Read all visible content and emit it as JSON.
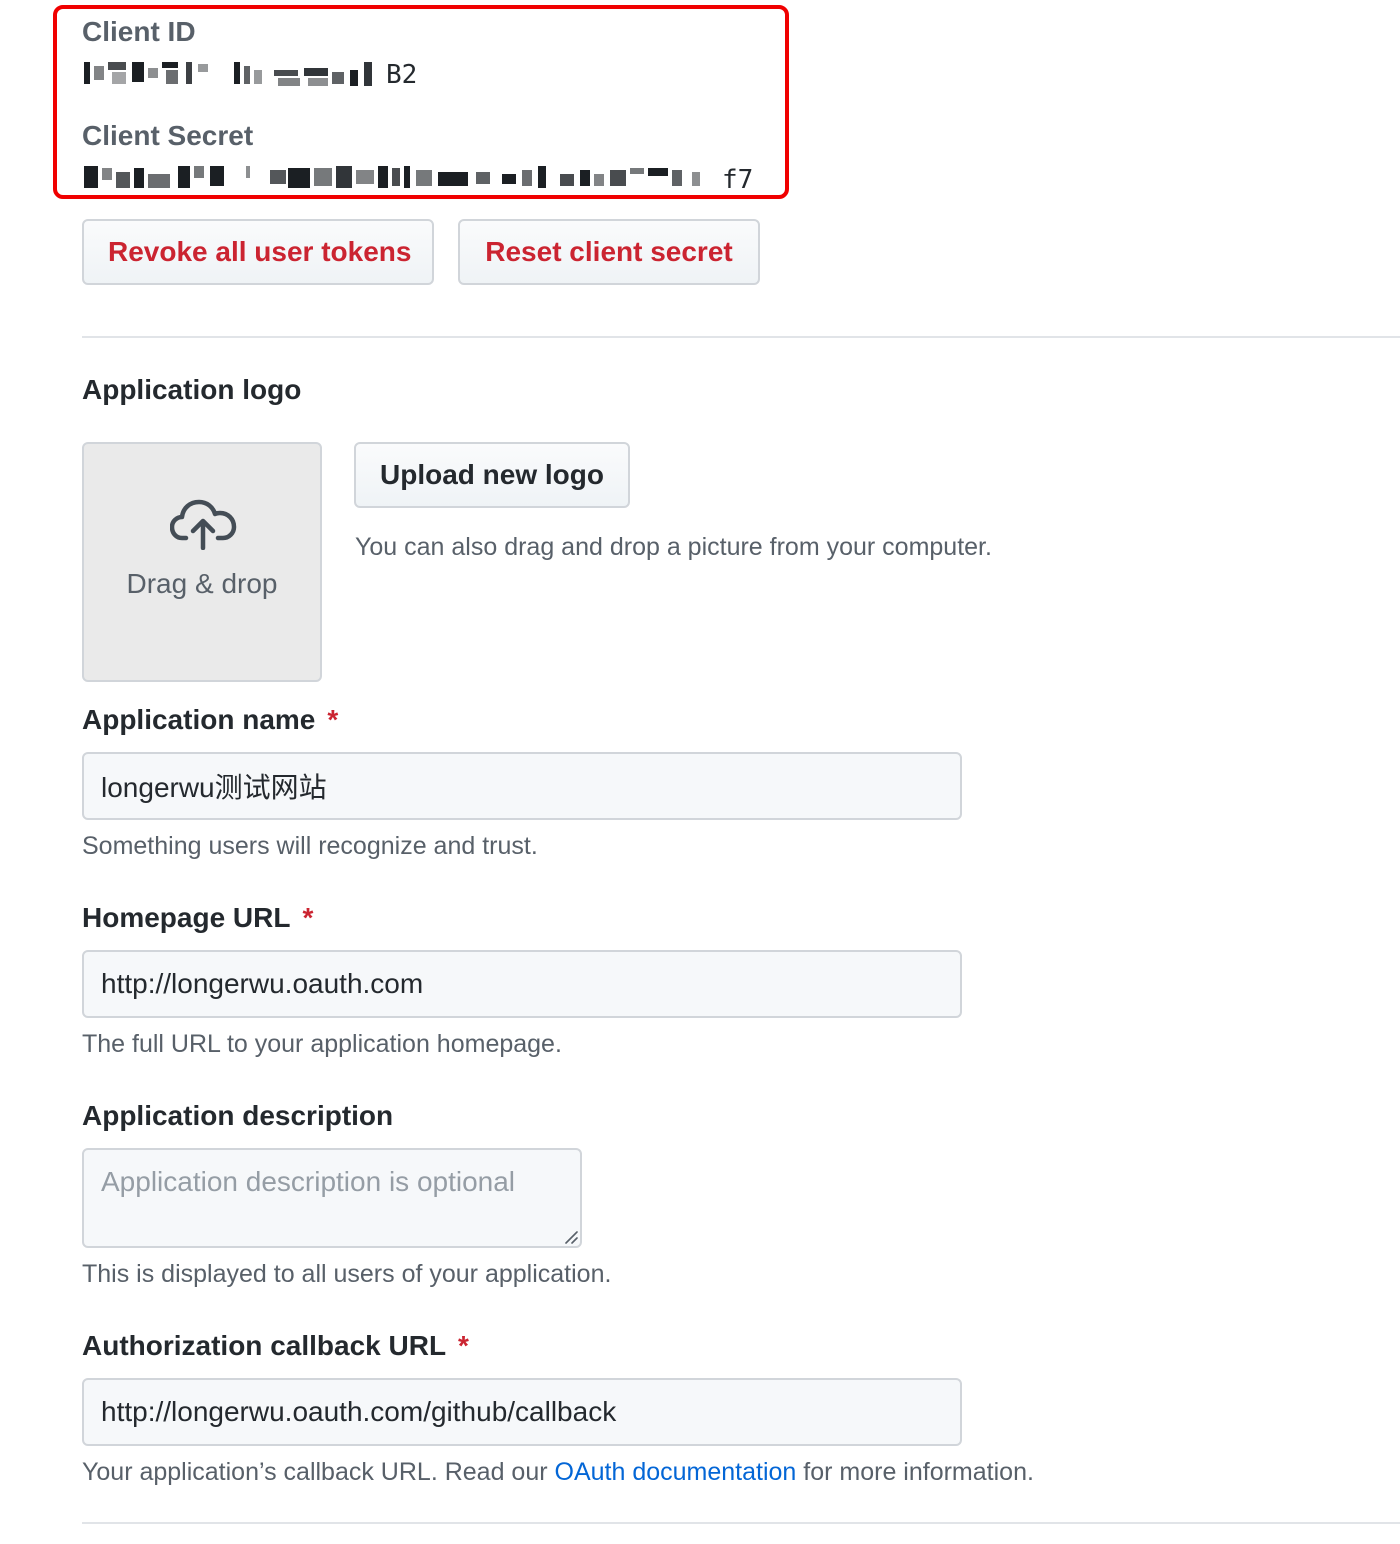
{
  "credentials": {
    "client_id_label": "Client ID",
    "client_id_value_visible_suffix": "B2",
    "client_secret_label": "Client Secret",
    "client_secret_value_visible_suffix": "f7"
  },
  "actions": {
    "revoke_tokens_label": "Revoke all user tokens",
    "reset_secret_label": "Reset client secret"
  },
  "logo": {
    "heading": "Application logo",
    "dropzone_label": "Drag & drop",
    "upload_button_label": "Upload new logo",
    "hint": "You can also drag and drop a picture from your computer."
  },
  "app_name": {
    "label": "Application name",
    "required_mark": "*",
    "value": "longerwu测试网站",
    "note": "Something users will recognize and trust."
  },
  "homepage": {
    "label": "Homepage URL",
    "required_mark": "*",
    "value": "http://longerwu.oauth.com",
    "note": "The full URL to your application homepage."
  },
  "description": {
    "label": "Application description",
    "placeholder": "Application description is optional",
    "value": "",
    "note": "This is displayed to all users of your application."
  },
  "callback": {
    "label": "Authorization callback URL",
    "required_mark": "*",
    "value": "http://longerwu.oauth.com/github/callback",
    "note_prefix": "Your application’s callback URL. Read our ",
    "note_link": "OAuth documentation",
    "note_suffix": " for more information."
  },
  "colors": {
    "highlight_box": "#f00000",
    "danger": "#cb2431",
    "link": "#0366d6",
    "muted": "#586069"
  },
  "icons": {
    "dropzone_icon": "cloud-upload-icon",
    "textarea_icon": "resize-grip-icon"
  }
}
